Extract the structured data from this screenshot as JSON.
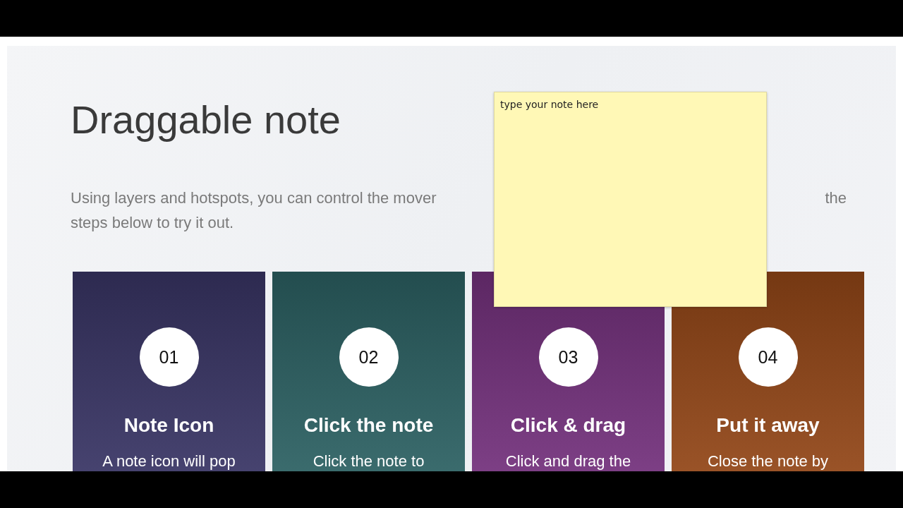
{
  "title": "Draggable note",
  "intro": {
    "line_1_start": "Using layers and hotspots, you can control the mover",
    "line_1_end": "the",
    "line_2": "steps below to try it out."
  },
  "steps": [
    {
      "number": "01",
      "title": "Note Icon",
      "text": "A note icon will pop",
      "color": "#3a3667"
    },
    {
      "number": "02",
      "title": "Click the note",
      "text": "Click the note to",
      "color": "#2d6365"
    },
    {
      "number": "03",
      "title": "Click & drag",
      "text": "Click and drag the",
      "color": "#76327f"
    },
    {
      "number": "04",
      "title": "Put it away",
      "text": "Close the note by",
      "color": "#964818"
    }
  ],
  "note": {
    "placeholder": "type your note here"
  }
}
